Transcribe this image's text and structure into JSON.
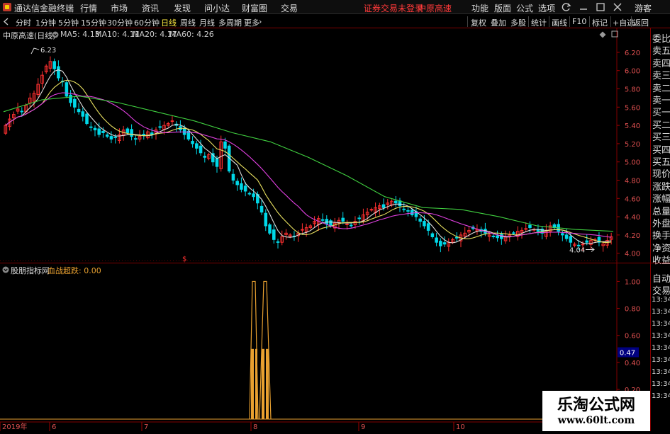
{
  "menubar": {
    "app_title": "通达信金融终端",
    "menu": [
      "行情",
      "市场",
      "资讯",
      "发现",
      "问小达",
      "财富圈",
      "交易"
    ],
    "status_text": "证券交易未登录",
    "stock_name": "中原高速",
    "right_menu": [
      "功能",
      "版面",
      "公式",
      "选项"
    ],
    "guest_label": "游客"
  },
  "toolbar": {
    "periods": [
      "分时",
      "1分钟",
      "5分钟",
      "15分钟",
      "30分钟",
      "60分钟",
      "日线",
      "周线",
      "月线",
      "多周期",
      "更多"
    ],
    "active_period": "日线",
    "right_buttons": [
      "复权",
      "叠加",
      "多股",
      "统计",
      "画线",
      "F10",
      "标记",
      "+自选",
      "返回"
    ]
  },
  "chart_header": {
    "title": "中原高速(日线)",
    "ma_labels": [
      "MA5: 4.13",
      "MA10: 4.11",
      "MA20: 4.17",
      "MA60: 4.26"
    ],
    "ma_colors": [
      "#dddddd",
      "#e8e060",
      "#e040e0",
      "#40d040"
    ]
  },
  "indicator_header": {
    "name": "股朋指标网",
    "value_label": "血战超跌: 0.00",
    "value_color": "#e8a030"
  },
  "annotations": {
    "high": "6.23",
    "low": "4.04",
    "current_ind": "0.47",
    "marker": "$"
  },
  "x_axis": [
    "2019年",
    "6",
    "7",
    "8",
    "9",
    "10"
  ],
  "right_panel": {
    "labels": [
      "委比",
      "卖五",
      "卖四",
      "卖三",
      "卖二",
      "卖一",
      "买一",
      "买二",
      "买三",
      "买四",
      "买五",
      "现价",
      "涨跌",
      "涨幅",
      "总量",
      "外盘",
      "换手",
      "净资",
      "收益"
    ],
    "trade_labels": [
      "自动",
      "交易"
    ],
    "times": [
      "13:34",
      "13:34",
      "13:34",
      "13:34",
      "13:34",
      "13:34",
      "13:34",
      "13:34",
      "13:34"
    ]
  },
  "watermark": {
    "line1": "乐淘公式网",
    "line2": "www.60lt.com"
  },
  "chart_data": [
    {
      "type": "candlestick",
      "title": "中原高速(日线)",
      "y_ticks": [
        6.2,
        6.0,
        5.8,
        5.6,
        5.4,
        5.2,
        5.0,
        4.8,
        4.6,
        4.4,
        4.2,
        4.0
      ],
      "ylim": [
        3.92,
        6.37
      ],
      "x_labels": [
        "2019年",
        "6",
        "7",
        "8",
        "9",
        "10"
      ],
      "colors": {
        "up": "#ff3030",
        "down": "#00d8e8"
      },
      "close_path_approx": [
        5.4,
        5.47,
        5.52,
        5.58,
        5.55,
        5.62,
        5.7,
        5.75,
        5.85,
        5.95,
        6.05,
        6.1,
        6.02,
        5.92,
        5.88,
        5.72,
        5.65,
        5.6,
        5.55,
        5.5,
        5.42,
        5.38,
        5.35,
        5.3,
        5.32,
        5.28,
        5.25,
        5.27,
        5.3,
        5.35,
        5.32,
        5.28,
        5.25,
        5.28,
        5.3,
        5.33,
        5.3,
        5.35,
        5.38,
        5.4,
        5.42,
        5.45,
        5.4,
        5.35,
        5.3,
        5.25,
        5.2,
        5.15,
        5.1,
        5.05,
        5.08,
        5.0,
        4.95,
        5.22,
        5.15,
        4.9,
        4.8,
        4.75,
        4.7,
        4.68,
        4.65,
        4.62,
        4.55,
        4.45,
        4.3,
        4.22,
        4.15,
        4.12,
        4.18,
        4.22,
        4.2,
        4.18,
        4.22,
        4.26,
        4.28,
        4.3,
        4.35,
        4.38,
        4.36,
        4.32,
        4.3,
        4.33,
        4.36,
        4.35,
        4.32,
        4.3,
        4.35,
        4.38,
        4.42,
        4.45,
        4.48,
        4.5,
        4.52,
        4.5,
        4.55,
        4.57,
        4.55,
        4.52,
        4.48,
        4.46,
        4.42,
        4.4,
        4.35,
        4.3,
        4.25,
        4.18,
        4.12,
        4.08,
        4.1,
        4.12,
        4.15,
        4.17,
        4.2,
        4.22,
        4.25,
        4.27,
        4.26,
        4.24,
        4.22,
        4.2,
        4.18,
        4.17,
        4.16,
        4.18,
        4.2,
        4.22,
        4.24,
        4.25,
        4.27,
        4.28,
        4.26,
        4.24,
        4.22,
        4.25,
        4.3,
        4.28,
        4.24,
        4.2,
        4.16,
        4.12,
        4.1,
        4.08,
        4.1,
        4.12,
        4.14,
        4.15,
        4.12,
        4.1,
        4.14,
        4.18
      ],
      "ma60_approx": [
        5.55,
        5.68,
        5.72,
        5.65,
        5.55,
        5.45,
        5.32,
        5.22,
        5.05,
        4.85,
        4.62,
        4.5,
        4.48,
        4.4,
        4.3,
        4.26,
        4.24
      ]
    },
    {
      "type": "bar",
      "title": "血战超跌",
      "y_ticks": [
        1.0,
        0.8,
        0.6,
        0.4,
        0.2
      ],
      "ylim": [
        -0.02,
        1.06
      ],
      "values_nonzero": [
        {
          "x": "8",
          "value": 1.0
        },
        {
          "x": "8",
          "value": 0.5
        }
      ],
      "current_value": 0.47,
      "color": "#e8a030"
    }
  ]
}
